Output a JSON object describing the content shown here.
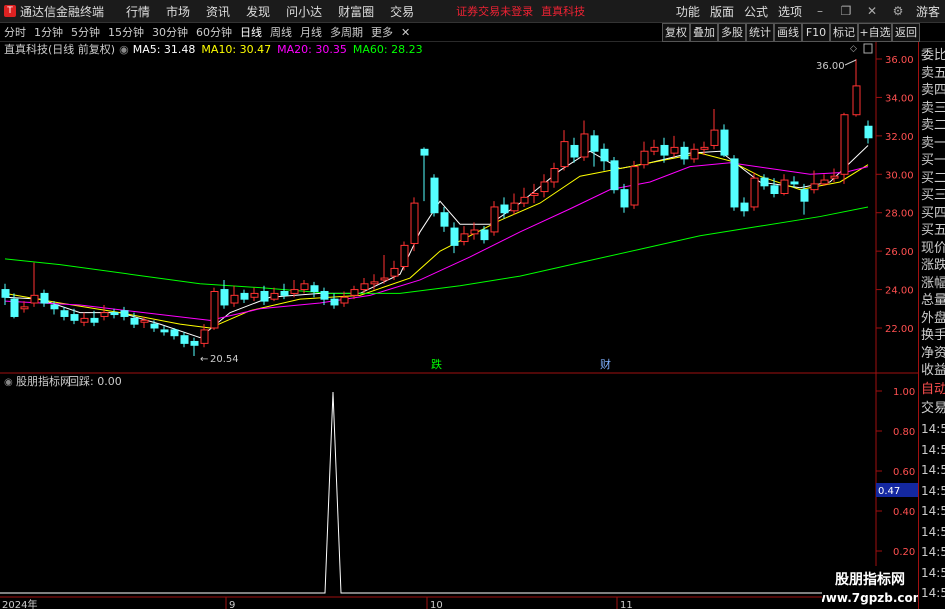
{
  "menubar": {
    "app_title": "通达信金融终端",
    "items": [
      "行情",
      "市场",
      "资讯",
      "发现",
      "问小达",
      "财富圈",
      "交易"
    ],
    "notice": "证券交易未登录",
    "stock_name": "直真科技",
    "right_items": [
      "功能",
      "版面",
      "公式",
      "选项"
    ],
    "guest": "游客"
  },
  "periods": {
    "items": [
      "分时",
      "1分钟",
      "5分钟",
      "15分钟",
      "30分钟",
      "60分钟",
      "日线",
      "周线",
      "月线",
      "多周期",
      "更多"
    ],
    "active": "日线"
  },
  "toolbar": [
    "复权",
    "叠加",
    "多股",
    "统计",
    "画线",
    "F10",
    "标记",
    "+自选",
    "返回"
  ],
  "price_chart": {
    "title": "直真科技(日线 前复权)",
    "ma_labels": [
      {
        "text": "MA5: 31.48",
        "color": "#ffffff"
      },
      {
        "text": "MA10: 30.47",
        "color": "#ffff00"
      },
      {
        "text": "MA20: 30.35",
        "color": "#ff00ff"
      },
      {
        "text": "MA60: 28.23",
        "color": "#00ff00"
      }
    ],
    "axis_labels": [
      "36.00",
      "34.00",
      "32.00",
      "30.00",
      "28.00",
      "26.00",
      "24.00",
      "22.00"
    ],
    "high_annotation": "36.00",
    "low_annotation": "20.54",
    "event_marks": [
      "跌",
      "财"
    ],
    "colors": {
      "up": "#ff3232",
      "down": "#54ffff",
      "ma5": "#ffffff",
      "ma10": "#ffff00",
      "ma20": "#ff00ff",
      "ma60": "#00ff00"
    }
  },
  "indicator": {
    "title": "股朋指标网",
    "value_label": "回踩: 0.00",
    "axis_labels": [
      "1.00",
      "0.80",
      "0.60",
      "0.40",
      "0.20"
    ],
    "current_value": "0.47"
  },
  "time_axis": [
    "2024年",
    "9",
    "10",
    "11"
  ],
  "side_panel": {
    "quote_items": [
      "委比",
      "卖五",
      "卖四",
      "卖三",
      "卖二",
      "卖一",
      "买一",
      "买二",
      "买三",
      "买四",
      "买五",
      "现价",
      "涨跌",
      "涨幅",
      "总量",
      "外盘",
      "换手",
      "净资",
      "收益"
    ],
    "auto_label": "自动",
    "trade_label": "交易",
    "times": [
      "14:56",
      "14:56",
      "14:56",
      "14:56",
      "14:56",
      "14:56",
      "14:56",
      "14:56",
      "14:56"
    ]
  },
  "watermark": {
    "line1": "股朋指标网",
    "line2": "www.7gpzb.com"
  }
}
